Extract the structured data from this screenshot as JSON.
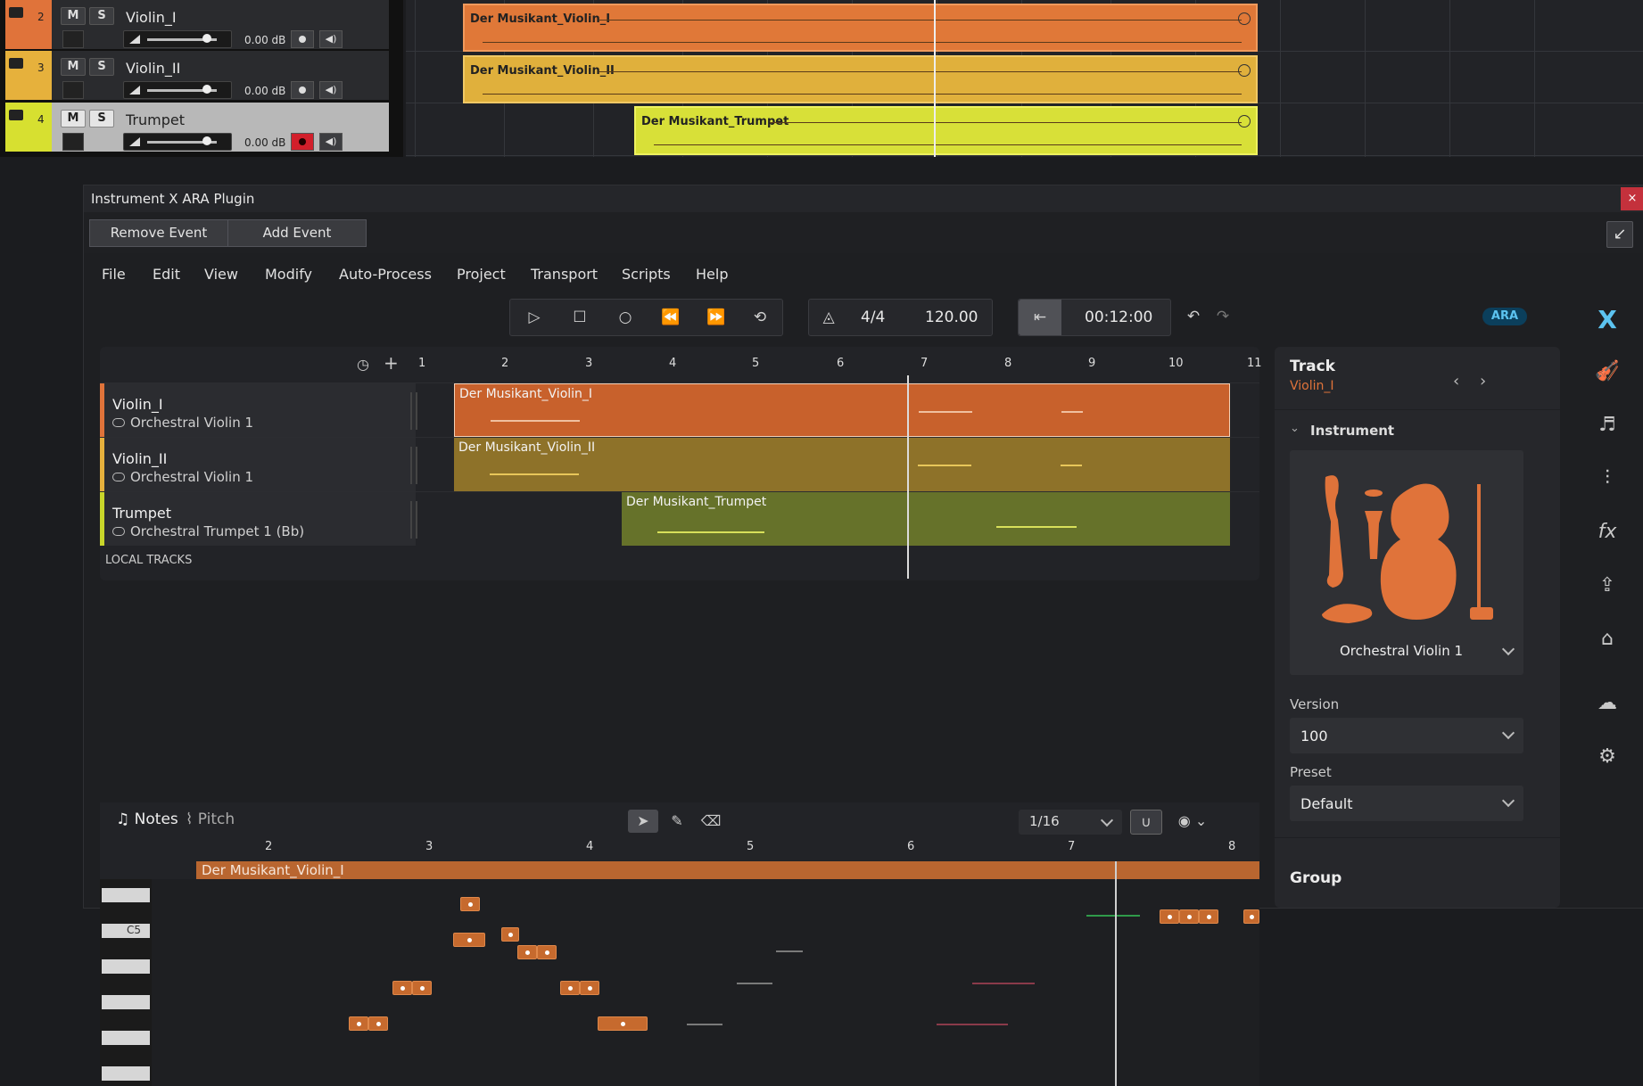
{
  "colors": {
    "track1": "#e0733a",
    "track2": "#e6b13c",
    "track3": "#d7e030",
    "clip1": "#c8612c",
    "clip2": "#9c7f30",
    "clip3": "#6d7b2e",
    "accent": "#e0733a",
    "ara": "#5cc3f0"
  },
  "daw": {
    "tracks": [
      {
        "num": "2",
        "name": "Violin_I",
        "mute": "M",
        "solo": "S",
        "volume": "0.00 dB"
      },
      {
        "num": "3",
        "name": "Violin_II",
        "mute": "M",
        "solo": "S",
        "volume": "0.00 dB"
      },
      {
        "num": "4",
        "name": "Trumpet",
        "mute": "M",
        "solo": "S",
        "volume": "0.00 dB"
      }
    ],
    "clips": [
      "Der Musikant_Violin_I",
      "Der Musikant_Violin_II",
      "Der Musikant_Trumpet"
    ]
  },
  "plugin": {
    "title": "Instrument X ARA Plugin",
    "close": "×",
    "remove_event": "Remove Event",
    "add_event": "Add Event",
    "menu": [
      "File",
      "Edit",
      "View",
      "Modify",
      "Auto-Process",
      "Project",
      "Transport",
      "Scripts",
      "Help"
    ],
    "transport": {
      "signature": "4/4",
      "tempo": "120.00",
      "time": "00:12:00"
    },
    "ara_badge": "ARA"
  },
  "arrangement": {
    "ruler": [
      "1",
      "2",
      "3",
      "4",
      "5",
      "6",
      "7",
      "8",
      "9",
      "10",
      "11"
    ],
    "tracks": [
      {
        "name": "Violin_I",
        "instrument": "Orchestral Violin 1",
        "clip": "Der Musikant_Violin_I"
      },
      {
        "name": "Violin_II",
        "instrument": "Orchestral Violin 1",
        "clip": "Der Musikant_Violin_II"
      },
      {
        "name": "Trumpet",
        "instrument": "Orchestral Trumpet 1 (Bb)",
        "clip": "Der Musikant_Trumpet"
      }
    ],
    "local_tracks": "LOCAL TRACKS"
  },
  "roll": {
    "tab_notes": "Notes",
    "tab_pitch": "Pitch",
    "quantize": "1/16",
    "ruler": [
      "2",
      "3",
      "4",
      "5",
      "6",
      "7",
      "8"
    ],
    "region": "Der Musikant_Violin_I",
    "c5_label": "C5"
  },
  "inspector": {
    "section": "Track",
    "track_name": "Violin_I",
    "instrument_header": "Instrument",
    "instrument_name": "Orchestral Violin 1",
    "version_label": "Version",
    "version_value": "100",
    "preset_label": "Preset",
    "preset_value": "Default",
    "group_label": "Group"
  }
}
